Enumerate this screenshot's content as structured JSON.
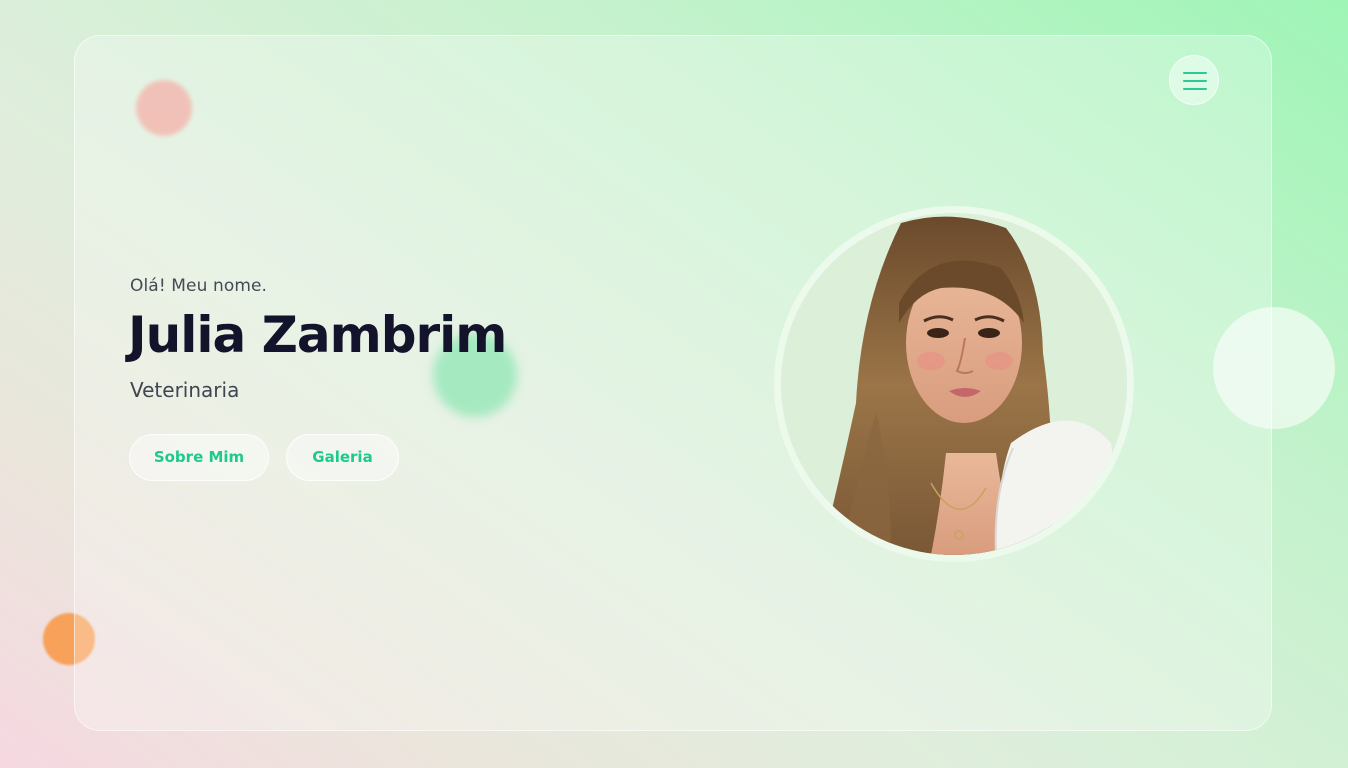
{
  "hero": {
    "greeting": "Olá! Meu nome.",
    "name": "Julia Zambrim",
    "profession": "Veterinaria"
  },
  "buttons": {
    "about_label": "Sobre Mim",
    "gallery_label": "Galeria"
  },
  "icons": {
    "menu": "hamburger-menu-icon"
  },
  "colors": {
    "accent": "#1fc98d",
    "name_text": "#13132b",
    "background_green": "#9ef5b6",
    "background_pink": "#f6d8e0"
  }
}
